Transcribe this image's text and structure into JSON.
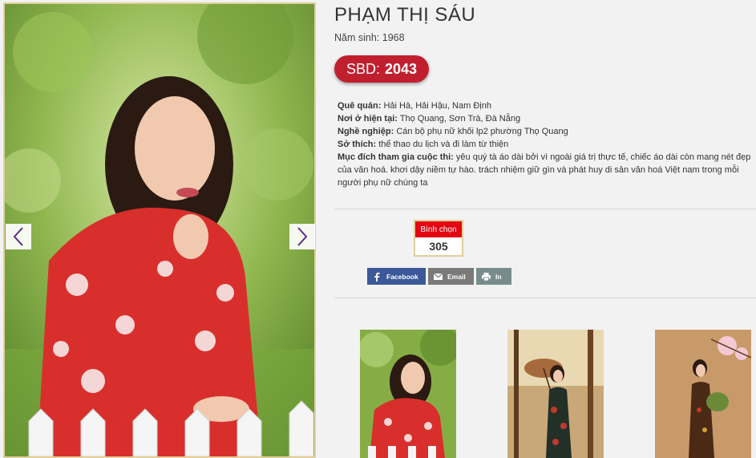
{
  "contestant": {
    "name": "PHẠM THỊ SÁU",
    "birth_year": "Năm sinh: 1968",
    "sbd_label": "SBD:",
    "sbd_number": "2043"
  },
  "info": {
    "hometown_label": "Quê quán:",
    "hometown_value": "Hải Hà, Hải Hậu, Nam Định",
    "residence_label": "Nơi ở hiện tại:",
    "residence_value": "Thọ Quang, Sơn Trà, Đà Nẵng",
    "occupation_label": "Nghề nghiệp:",
    "occupation_value": "Cán bộ phụ nữ khối lp2 phường Thọ Quang",
    "hobby_label": "Sở thích:",
    "hobby_value": "thể thao du lịch và đi làm từ thiện",
    "purpose_label": "Mục đích tham gia cuộc thi:",
    "purpose_value": "yêu quý tà áo dài bởi vì ngoài giá trị thực tế, chiếc áo dài còn mang nét đẹp của văn hoá. khơi dậy niềm tự hào. trách nhiệm giữ gìn và phát huy di sản văn hoá Việt nam trong mỗi người phụ nữ chúng ta"
  },
  "vote": {
    "label": "Bình chọn",
    "count": "305"
  },
  "share": {
    "facebook": "Facebook",
    "email": "Email",
    "print": "In"
  },
  "colors": {
    "accent_red": "#c0202e",
    "vote_red": "#e30613",
    "facebook_blue": "#3b5998",
    "gold_border": "#e2cf9c"
  },
  "icons": {
    "prev": "chevron-left-icon",
    "next": "chevron-right-icon",
    "facebook": "facebook-icon",
    "email": "envelope-icon",
    "print": "printer-icon"
  }
}
